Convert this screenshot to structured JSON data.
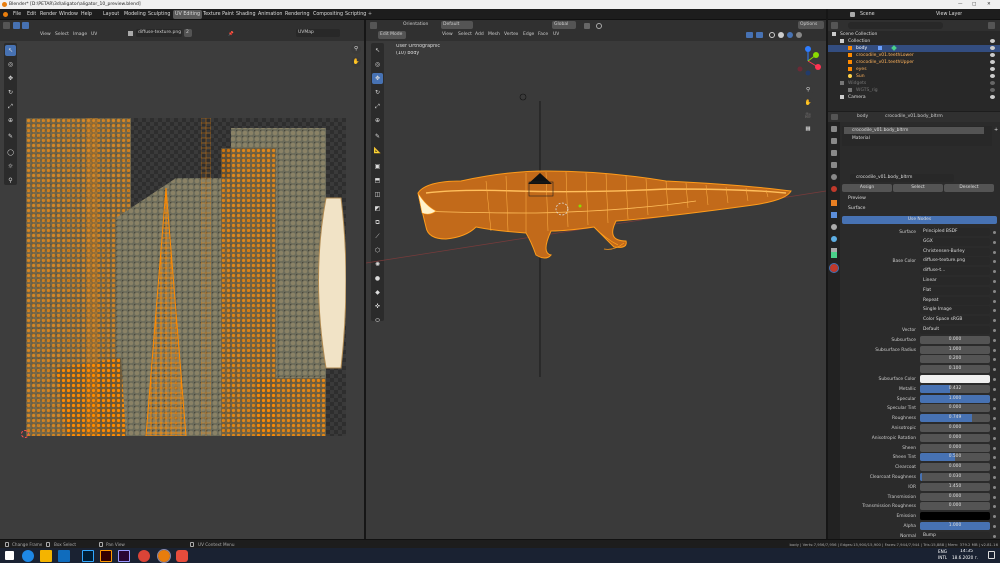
{
  "window_title": "Blender* [D:\\PETAR\\3d\\aligator\\aligator_10_preview.blend]",
  "menu": [
    "File",
    "Edit",
    "Render",
    "Window",
    "Help"
  ],
  "workspaces": [
    "Layout",
    "Modeling",
    "Sculpting",
    "UV Editing",
    "Texture Paint",
    "Shading",
    "Animation",
    "Rendering",
    "Compositing",
    "Scripting"
  ],
  "active_workspace": "UV Editing",
  "scene": "Scene",
  "view_layer": "View Layer",
  "uv_editor": {
    "menus": [
      "View",
      "Select",
      "Image",
      "UV"
    ],
    "image_name": "diffuse-texture.png",
    "image_users": "2",
    "uv_map": "UVMap"
  },
  "viewport": {
    "mode": "Edit Mode",
    "orientation_label": "Orientation",
    "orientation_value": "Default",
    "menus": [
      "View",
      "Select",
      "Add",
      "Mesh",
      "Vertex",
      "Edge",
      "Face",
      "UV"
    ],
    "transform": "Global",
    "options": "Options",
    "overlay_title": "User Orthographic",
    "overlay_object": "(10) body"
  },
  "outliner": {
    "rows": [
      {
        "name": "Scene Collection",
        "indent": 0,
        "color": "#ddd"
      },
      {
        "name": "Collection",
        "indent": 1,
        "color": "#ddd"
      },
      {
        "name": "body",
        "indent": 2,
        "color": "#ffffff",
        "selected": true
      },
      {
        "name": "crocodile_v01.teethLower",
        "indent": 2,
        "color": "#ffb35c"
      },
      {
        "name": "crocodile_v01.teethUpper",
        "indent": 2,
        "color": "#ffb35c"
      },
      {
        "name": "eyes",
        "indent": 2,
        "color": "#ffb35c"
      },
      {
        "name": "Sun",
        "indent": 2,
        "color": "#ffb35c"
      },
      {
        "name": "Widgets",
        "indent": 1,
        "color": "#777"
      },
      {
        "name": "WGTS_rig",
        "indent": 2,
        "color": "#777"
      },
      {
        "name": "Camera",
        "indent": 1,
        "color": "#ddd"
      }
    ]
  },
  "properties": {
    "object": "body",
    "material": "crocodile_v01.body_bl",
    "material_slot": "crocodile_v01.body_bltrm",
    "slot2": "Material",
    "material_datablock": "crocodile_v01.body_bltrm",
    "assign": "Assign",
    "select": "Select",
    "deselect": "Deselect",
    "preview": "Preview",
    "surface": "Surface",
    "use_nodes": "Use Nodes",
    "rows": [
      {
        "label": "Surface",
        "value": "Principled BSDF",
        "kind": "dd"
      },
      {
        "label": "",
        "value": "GGX",
        "kind": "dd"
      },
      {
        "label": "",
        "value": "Christensen-Burley",
        "kind": "dd"
      },
      {
        "label": "Base Color",
        "value": "diffuse-texture.png",
        "kind": "dd"
      },
      {
        "label": "",
        "value": "diffuse-t...",
        "kind": "dd"
      },
      {
        "label": "",
        "value": "Linear",
        "kind": "dd"
      },
      {
        "label": "",
        "value": "Flat",
        "kind": "dd"
      },
      {
        "label": "",
        "value": "Repeat",
        "kind": "dd"
      },
      {
        "label": "",
        "value": "Single Image",
        "kind": "dd"
      },
      {
        "label": "",
        "value": "Color Space      sRGB",
        "kind": "dd"
      },
      {
        "label": "Vector",
        "value": "Default",
        "kind": "dd"
      },
      {
        "label": "Subsurface",
        "value": "0.000",
        "kind": "num",
        "fill": 0
      },
      {
        "label": "Subsurface Radius",
        "value": "1.000",
        "kind": "num",
        "fill": 0
      },
      {
        "label": "",
        "value": "0.200",
        "kind": "num",
        "fill": 0
      },
      {
        "label": "",
        "value": "0.100",
        "kind": "num",
        "fill": 0
      },
      {
        "label": "Subsurface Color",
        "value": "",
        "kind": "white"
      },
      {
        "label": "Metallic",
        "value": "0.432",
        "kind": "num",
        "fill": 0.432
      },
      {
        "label": "Specular",
        "value": "1.000",
        "kind": "num",
        "fill": 1
      },
      {
        "label": "Specular Tint",
        "value": "0.000",
        "kind": "num",
        "fill": 0
      },
      {
        "label": "Roughness",
        "value": "0.749",
        "kind": "num",
        "fill": 0.749
      },
      {
        "label": "Anisotropic",
        "value": "0.000",
        "kind": "num",
        "fill": 0
      },
      {
        "label": "Anisotropic Rotation",
        "value": "0.000",
        "kind": "num",
        "fill": 0
      },
      {
        "label": "Sheen",
        "value": "0.000",
        "kind": "num",
        "fill": 0
      },
      {
        "label": "Sheen Tint",
        "value": "0.500",
        "kind": "num",
        "fill": 0.5
      },
      {
        "label": "Clearcoat",
        "value": "0.000",
        "kind": "num",
        "fill": 0
      },
      {
        "label": "Clearcoat Roughness",
        "value": "0.030",
        "kind": "num",
        "fill": 0.03
      },
      {
        "label": "IOR",
        "value": "1.450",
        "kind": "num",
        "fill": 0
      },
      {
        "label": "Transmission",
        "value": "0.000",
        "kind": "num",
        "fill": 0
      },
      {
        "label": "Transmission Roughness",
        "value": "0.000",
        "kind": "num",
        "fill": 0
      },
      {
        "label": "Emission",
        "value": "",
        "kind": "black"
      },
      {
        "label": "Alpha",
        "value": "1.000",
        "kind": "num",
        "fill": 1
      },
      {
        "label": "Normal",
        "value": "Bump",
        "kind": "dd"
      }
    ]
  },
  "status": {
    "change_frame": "Change Frame",
    "box_select": "Box Select",
    "pan_view": "Pan View",
    "context_menu": "UV Context Menu",
    "stats": "body | Verts:7,956/7,956 | Edges:15,900/15,900 | Faces:7,944/7,944 | Tris:15,888 | Mem: 379.2 MB | v2.81.16"
  },
  "taskbar": {
    "lang": "ENG",
    "lang2": "INTL",
    "time": "14:35",
    "date": "18.6.2020 г."
  },
  "colors": {
    "accent": "#4772b3",
    "selection_orange": "#ff8a00",
    "header": "#303030"
  }
}
